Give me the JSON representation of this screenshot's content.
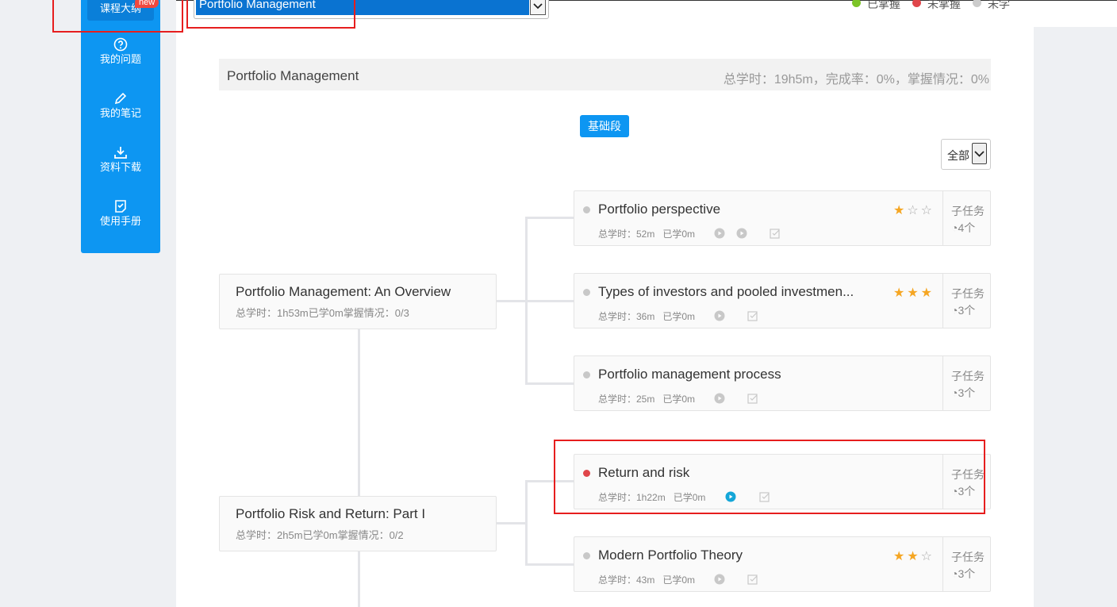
{
  "sidebar": {
    "top_label": "课程大纲",
    "new_badge": "new",
    "items": [
      {
        "icon": "question-icon",
        "label": "我的问题"
      },
      {
        "icon": "pencil-icon",
        "label": "我的笔记"
      },
      {
        "icon": "download-icon",
        "label": "资料下载"
      },
      {
        "icon": "manual-icon",
        "label": "使用手册"
      }
    ]
  },
  "header": {
    "course_select": "Portfolio Management",
    "legend": [
      {
        "label": "已掌握",
        "color": "#7cc427"
      },
      {
        "label": "未掌握",
        "color": "#e0464a"
      },
      {
        "label": "未学",
        "color": "#cccccc"
      }
    ]
  },
  "course": {
    "title": "Portfolio Management",
    "stats": "总学时：19h5m，完成率：0%，掌握情况：0%",
    "stage_button": "基础段",
    "filter_value": "全部"
  },
  "nodes": [
    {
      "title": "Portfolio Management: An Overview",
      "sub": "总学时：1h53m已学0m掌握情况：0/3"
    },
    {
      "title": "Portfolio Risk and Return: Part I",
      "sub": "总学时：2h5m已学0m掌握情况：0/2"
    }
  ],
  "tasks": [
    {
      "title": "Portfolio perspective",
      "total": "总学时：52m",
      "learned": "已学0m",
      "stars": 1,
      "subtask_label": "子任务",
      "subtask_count": "4个",
      "status_color": "#c8c8c8"
    },
    {
      "title": "Types of investors and pooled investmen...",
      "total": "总学时：36m",
      "learned": "已学0m",
      "stars": 3,
      "subtask_label": "子任务",
      "subtask_count": "3个",
      "status_color": "#c8c8c8"
    },
    {
      "title": "Portfolio management process",
      "total": "总学时：25m",
      "learned": "已学0m",
      "stars": 0,
      "subtask_label": "子任务",
      "subtask_count": "3个",
      "status_color": "#c8c8c8"
    },
    {
      "title": "Return and risk",
      "total": "总学时：1h22m",
      "learned": "已学0m",
      "stars": 0,
      "subtask_label": "子任务",
      "subtask_count": "3个",
      "status_color": "#e0464a"
    },
    {
      "title": "Modern Portfolio Theory",
      "total": "总学时：43m",
      "learned": "已学0m",
      "stars": 2,
      "subtask_label": "子任务",
      "subtask_count": "3个",
      "status_color": "#c8c8c8"
    }
  ],
  "colors": {
    "accent": "#0d96f2",
    "highlight": "#e61e1e",
    "star": "#f5a623"
  }
}
